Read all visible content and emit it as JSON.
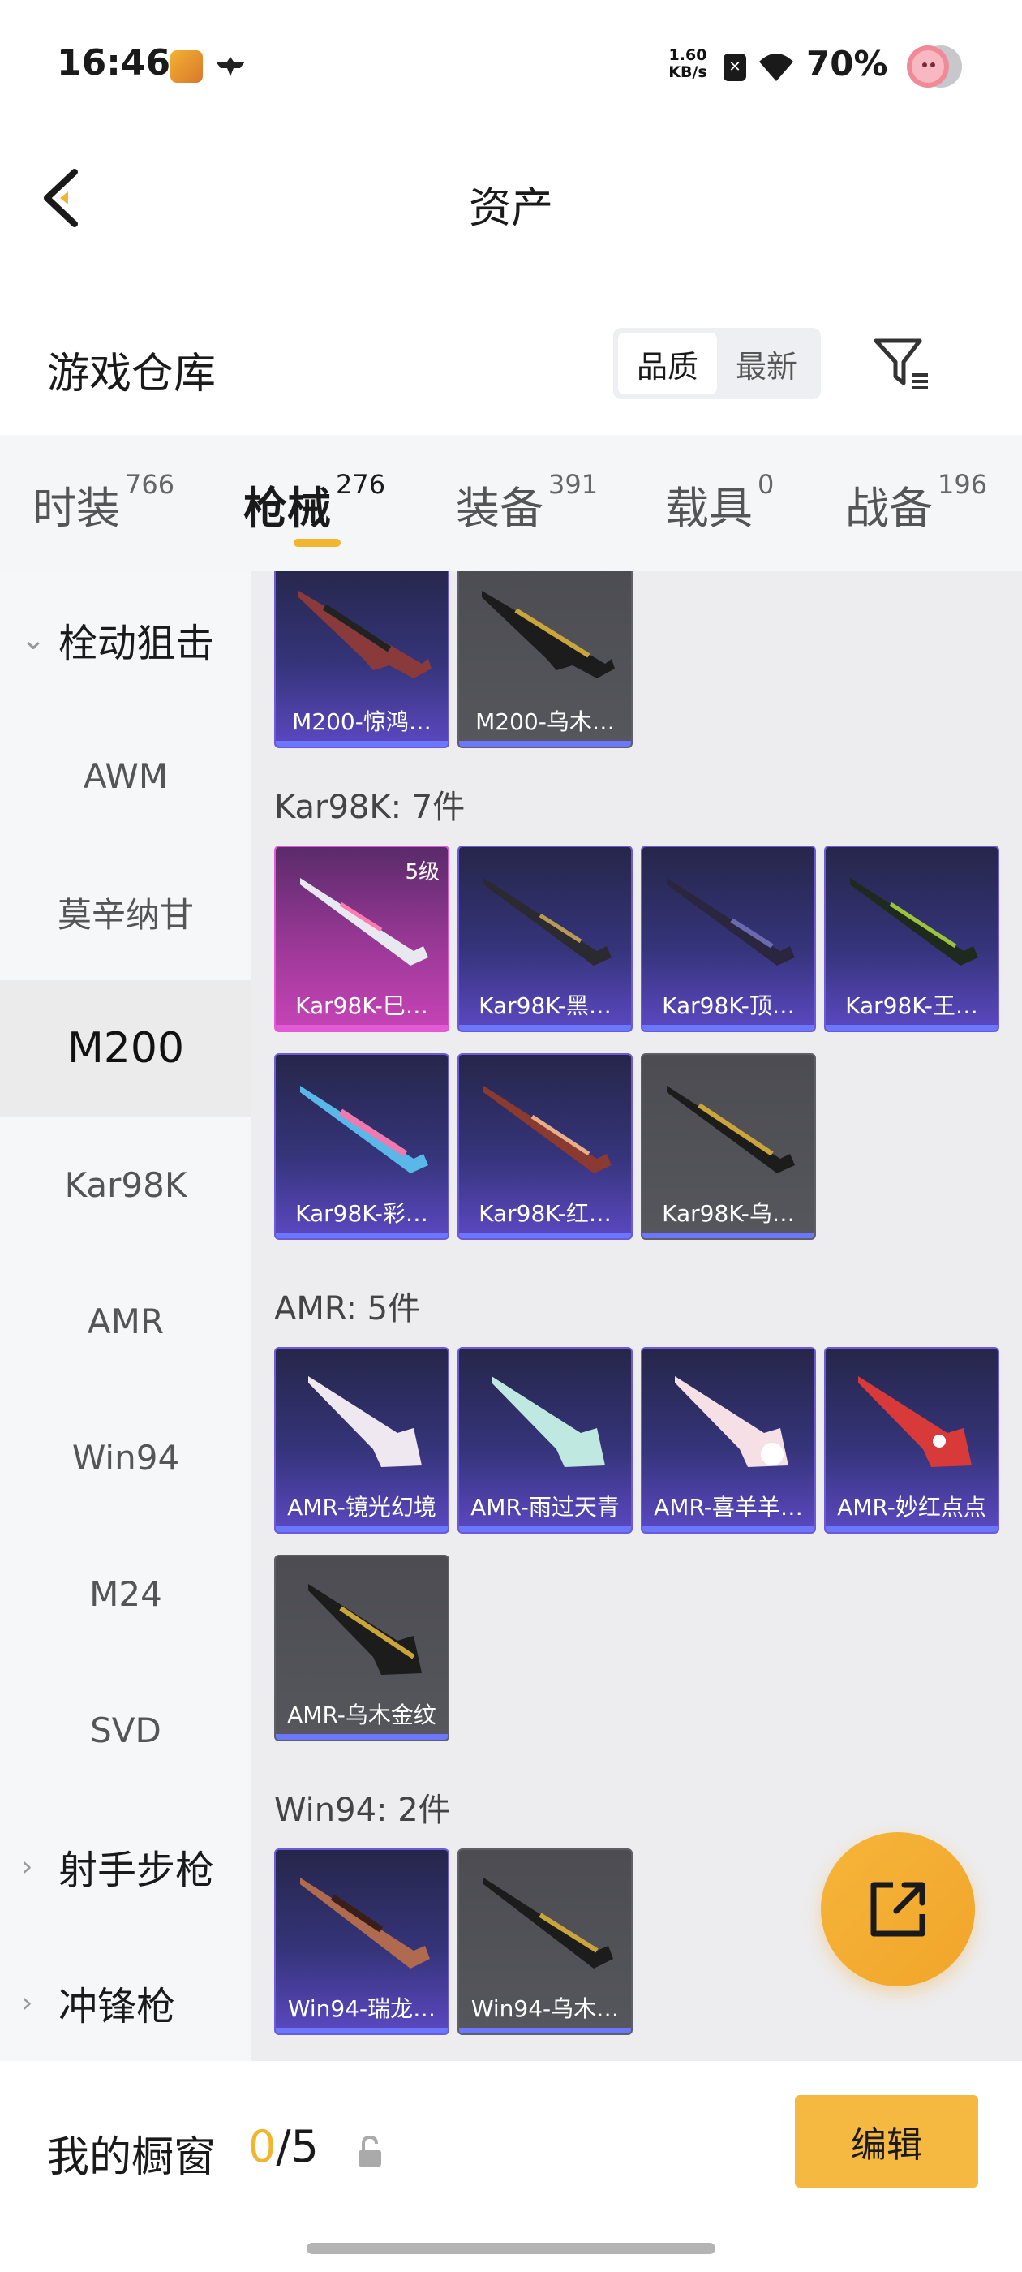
{
  "status_bar": {
    "time": "16:46",
    "net_speed_value": "1.60",
    "net_speed_unit": "KB/s",
    "sim_label": "✕",
    "battery": "70%"
  },
  "header": {
    "title": "资产",
    "back_icon": "chevron-left-icon"
  },
  "warehouse": {
    "title": "游戏仓库",
    "sort_options": [
      "品质",
      "最新"
    ],
    "active_sort": "品质",
    "filter_icon": "filter-icon"
  },
  "tabs": [
    {
      "label": "时装",
      "count": "766"
    },
    {
      "label": "枪械",
      "count": "276",
      "active": true
    },
    {
      "label": "装备",
      "count": "391"
    },
    {
      "label": "载具",
      "count": "0"
    },
    {
      "label": "战备",
      "count": "196"
    }
  ],
  "sidebar": {
    "group_bolt": "栓动狙击",
    "items": [
      "AWM",
      "莫辛纳甘",
      "M200",
      "Kar98K",
      "AMR",
      "Win94",
      "M24",
      "SVD"
    ],
    "active_item": "M200",
    "group_marksman": "射手步枪",
    "group_smg": "冲锋枪"
  },
  "sections": {
    "m200": {
      "cards": [
        {
          "name": "M200-惊鸿…",
          "rarity": "purple"
        },
        {
          "name": "M200-乌木…",
          "rarity": "gray"
        }
      ]
    },
    "kar98k": {
      "title": "Kar98K: 7件",
      "cards": [
        {
          "name": "Kar98K-巳…",
          "rarity": "pink",
          "level": "5级"
        },
        {
          "name": "Kar98K-黑…",
          "rarity": "purple"
        },
        {
          "name": "Kar98K-顶…",
          "rarity": "purple"
        },
        {
          "name": "Kar98K-王…",
          "rarity": "purple"
        },
        {
          "name": "Kar98K-彩…",
          "rarity": "purple"
        },
        {
          "name": "Kar98K-红…",
          "rarity": "purple"
        },
        {
          "name": "Kar98K-乌…",
          "rarity": "gray"
        }
      ]
    },
    "amr": {
      "title": "AMR: 5件",
      "cards": [
        {
          "name": "AMR-镜光幻境",
          "rarity": "purple"
        },
        {
          "name": "AMR-雨过天青",
          "rarity": "purple"
        },
        {
          "name": "AMR-喜羊羊…",
          "rarity": "purple"
        },
        {
          "name": "AMR-妙红点点",
          "rarity": "purple"
        },
        {
          "name": "AMR-乌木金纹",
          "rarity": "gray"
        }
      ]
    },
    "win94": {
      "title": "Win94: 2件",
      "cards": [
        {
          "name": "Win94-瑞龙…",
          "rarity": "purple"
        },
        {
          "name": "Win94-乌木…",
          "rarity": "gray"
        }
      ]
    }
  },
  "fab_icon": "share-external-icon",
  "showcase": {
    "title": "我的橱窗",
    "current": "0",
    "separator_total": "/5",
    "lock_icon": "lock-icon",
    "edit_label": "编辑"
  },
  "colors": {
    "accent": "#f2b530",
    "purple_card": "#35347a",
    "gray_card": "#56565d",
    "pink_card": "#a23a9c"
  }
}
